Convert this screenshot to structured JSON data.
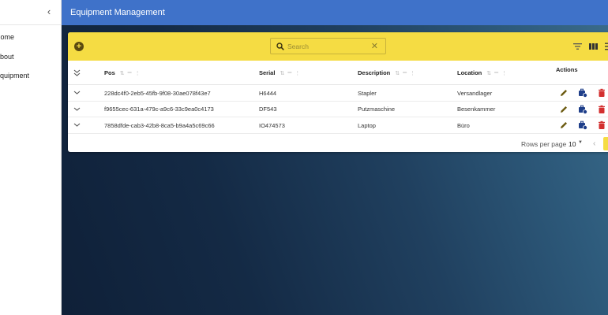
{
  "sidebar": {
    "items": [
      {
        "label": "Home"
      },
      {
        "label": "About"
      },
      {
        "label": "Equipment"
      }
    ]
  },
  "header": {
    "title": "Equipment Management"
  },
  "toolbar": {
    "search_placeholder": "Search"
  },
  "table": {
    "columns": [
      "Pos",
      "Serial",
      "Description",
      "Location",
      "Actions"
    ],
    "rows": [
      {
        "pos": "228dc4f0-2eb5-45fb-9f08-30ae078f43e7",
        "serial": "H6444",
        "description": "Stapler",
        "location": "Versandlager"
      },
      {
        "pos": "f9655cec-631a-479c-a9c6-33c9ea0c4173",
        "serial": "DF543",
        "description": "Putzmaschine",
        "location": "Besenkammer"
      },
      {
        "pos": "7858dfde-cab3-42b8-8ca5-b9a4a5c69c66",
        "serial": "IO474573",
        "description": "Laptop",
        "location": "Büro"
      }
    ]
  },
  "footer": {
    "rows_per_page_label": "Rows per page",
    "rows_per_page_value": "10"
  },
  "colors": {
    "accent": "#f5dc43",
    "appbar": "#3f72c9",
    "edit": "#6b5a10",
    "transfer": "#1f3f8a",
    "delete": "#d32f2f"
  }
}
